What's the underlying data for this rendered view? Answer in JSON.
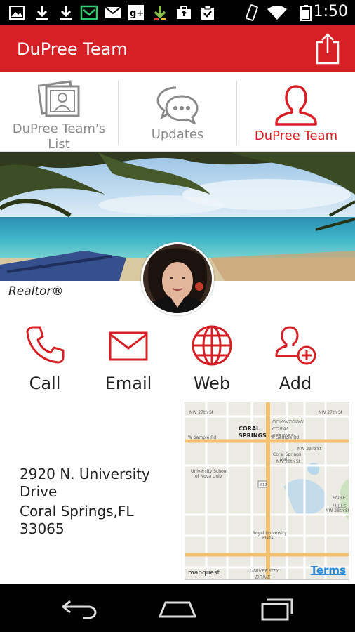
{
  "status_bar": {
    "time": "1:50",
    "icons": [
      "gallery-icon",
      "download-icon",
      "download-icon",
      "inbox-icon",
      "gmail-icon",
      "google-plus-icon",
      "app-download-icon",
      "briefcase-icon",
      "clipboard-check-icon",
      "vibrate-icon",
      "wifi-icon",
      "battery-icon"
    ]
  },
  "app_bar": {
    "title": "DuPree Team",
    "share_icon": "share-icon",
    "color": "#d71f26"
  },
  "tabs": [
    {
      "label": "DuPree Team's List",
      "icon": "photos-icon",
      "active": false
    },
    {
      "label": "Updates",
      "icon": "chat-bubbles-icon",
      "active": false
    },
    {
      "label": "DuPree Team",
      "icon": "person-icon",
      "active": true
    }
  ],
  "profile": {
    "tagline": "Realtor®"
  },
  "actions": [
    {
      "label": "Call",
      "icon": "phone-icon"
    },
    {
      "label": "Email",
      "icon": "envelope-icon"
    },
    {
      "label": "Web",
      "icon": "globe-icon"
    },
    {
      "label": "Add",
      "icon": "add-contact-icon"
    }
  ],
  "address": {
    "line1": "2920 N. University Drive",
    "line2": "Coral Springs,FL 33065"
  },
  "map": {
    "city_label": "CORAL SPRINGS",
    "downtown_label": "DOWNTOWN CORAL SPRINGS",
    "terms_label": "Terms",
    "provider": "mapquest",
    "street_labels": [
      "NW 27th St",
      "W Sample Rd",
      "NW 23rd St",
      "NW 20th St",
      "NW 25th Ave",
      "NW 28th Ave",
      "Royal University Plaza",
      "UNIVERSITY DRIVE",
      "Coral Springs Mall",
      "University School of Nova Univ",
      "FOREST HILLS",
      "817"
    ]
  },
  "nav_bar": {
    "buttons": [
      "back-icon",
      "home-icon",
      "recents-icon"
    ]
  }
}
